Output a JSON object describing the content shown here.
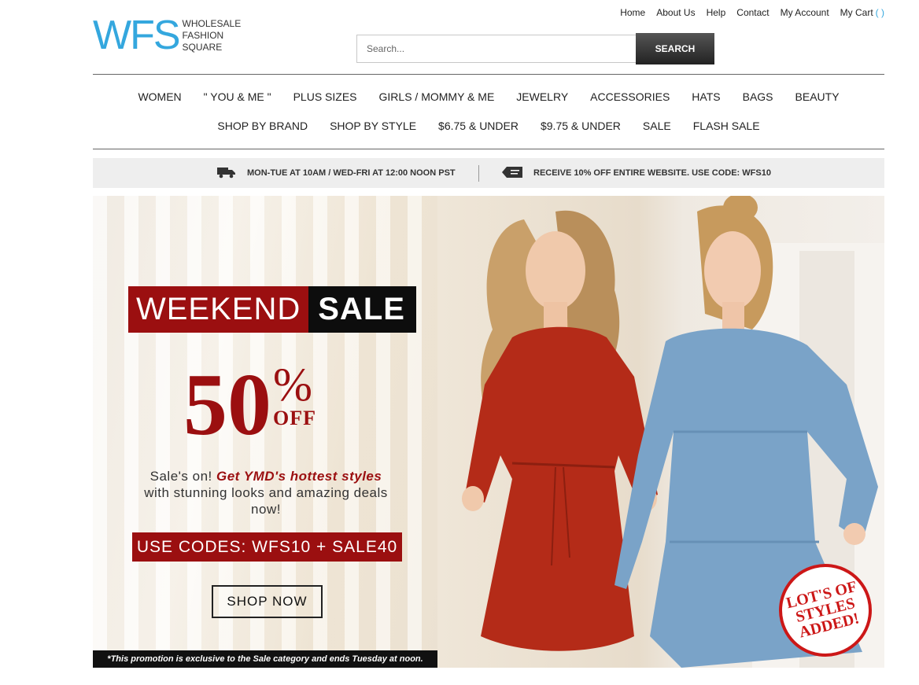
{
  "brand": {
    "logo_mark": "WFS",
    "logo_lines": [
      "WHOLESALE",
      "FASHION",
      "SQUARE"
    ]
  },
  "top_links": [
    "Home",
    "About Us",
    "Help",
    "Contact",
    "My Account",
    "My Cart"
  ],
  "cart_count": "( )",
  "search": {
    "placeholder": "Search...",
    "button": "SEARCH"
  },
  "nav_row1": [
    "WOMEN",
    "\" YOU & ME \"",
    "PLUS SIZES",
    "GIRLS / MOMMY & ME",
    "JEWELRY",
    "ACCESSORIES",
    "HATS",
    "BAGS",
    "BEAUTY"
  ],
  "nav_row2": [
    "SHOP BY BRAND",
    "SHOP BY STYLE",
    "$6.75 & UNDER",
    "$9.75 & UNDER",
    "SALE",
    "FLASH SALE"
  ],
  "info": {
    "shipping": "MON-TUE AT 10AM / WED-FRI AT 12:00 NOON PST",
    "discount": "RECEIVE 10% OFF ENTIRE WEBSITE. USE CODE: WFS10"
  },
  "banner": {
    "weekend": "WEEKEND",
    "sale": "SALE",
    "percent": "50",
    "percent_sign": "%",
    "off": "OFF",
    "tagline_1": "Sale's on! ",
    "tagline_em": "Get YMD's hottest styles",
    "tagline_2": " with stunning looks and amazing deals now!",
    "codes": "USE CODES: WFS10 + SALE40",
    "shop_now": "SHOP NOW",
    "disclaimer": "*This promotion is exclusive to the Sale category and ends Tuesday at noon.",
    "stamp": [
      "LOT'S OF",
      "STYLES",
      "ADDED!"
    ]
  },
  "colors": {
    "brand_blue": "#34a7de",
    "sale_red": "#9b0f10",
    "stamp_red": "#cc1717"
  }
}
